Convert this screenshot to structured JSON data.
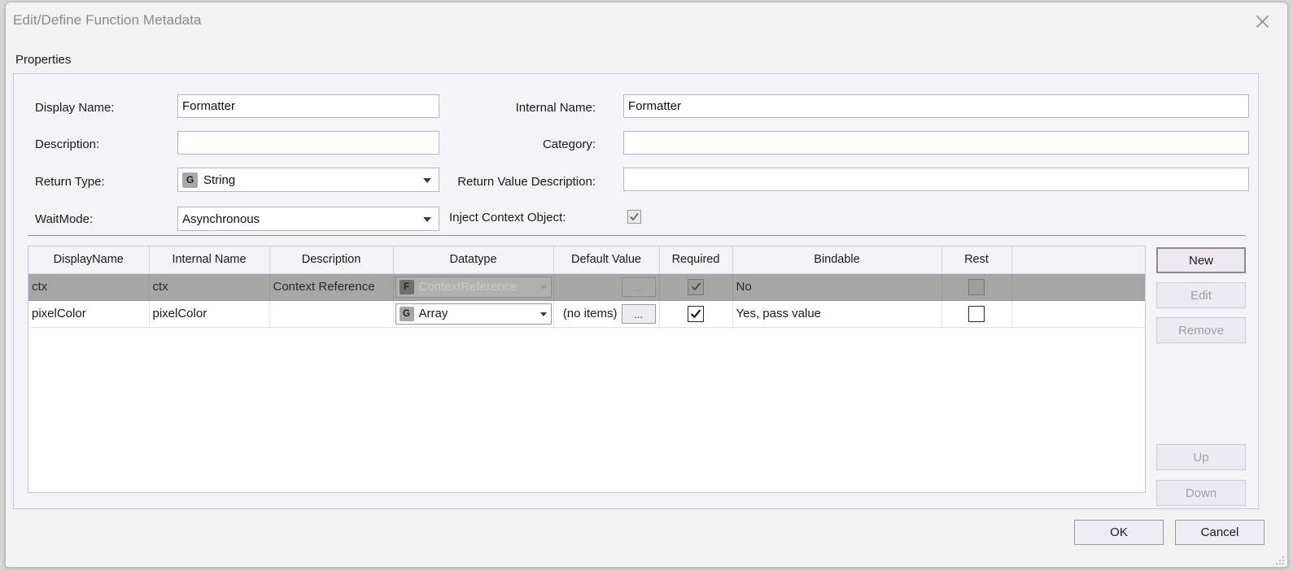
{
  "window": {
    "title": "Edit/Define Function Metadata",
    "close_icon": "close-icon"
  },
  "properties": {
    "section_label": "Properties",
    "fields": {
      "display_name": {
        "label": "Display Name:",
        "value": "Formatter",
        "placeholder": ""
      },
      "description": {
        "label": "Description:",
        "value": "",
        "placeholder": ""
      },
      "return_type": {
        "label": "Return Type:",
        "value": "String",
        "icon": "G"
      },
      "wait_mode": {
        "label": "WaitMode:",
        "value": "Asynchronous"
      },
      "internal_name": {
        "label": "Internal Name:",
        "value": "Formatter",
        "placeholder": ""
      },
      "category": {
        "label": "Category:",
        "value": "",
        "placeholder": ""
      },
      "return_value_description": {
        "label": "Return Value Description:",
        "value": "",
        "placeholder": ""
      },
      "inject_context_object": {
        "label": "Inject Context Object:",
        "checked": true
      }
    }
  },
  "table": {
    "columns": [
      "DisplayName",
      "Internal Name",
      "Description",
      "Datatype",
      "Default Value",
      "Required",
      "Bindable",
      "Rest",
      ""
    ],
    "rows": [
      {
        "selected": true,
        "display_name": "ctx",
        "internal_name": "ctx",
        "description": "Context Reference",
        "datatype": {
          "text": "ContextReference",
          "icon": "F",
          "disabled": true
        },
        "default_value": {
          "text": "",
          "button_label": "...",
          "disabled": true
        },
        "required": {
          "checked": true,
          "disabled": true
        },
        "bindable": "No",
        "rest": {
          "checked": false,
          "disabled": true
        },
        "extra": ""
      },
      {
        "selected": false,
        "display_name": "pixelColor",
        "internal_name": "pixelColor",
        "description": "",
        "datatype": {
          "text": "Array",
          "icon": "G",
          "disabled": false
        },
        "default_value": {
          "text": "(no items)",
          "button_label": "...",
          "disabled": false
        },
        "required": {
          "checked": true,
          "disabled": false
        },
        "bindable": "Yes, pass value",
        "rest": {
          "checked": false,
          "disabled": false
        },
        "extra": ""
      }
    ]
  },
  "side_buttons": {
    "new": {
      "label": "New",
      "enabled": true,
      "default": true
    },
    "edit": {
      "label": "Edit",
      "enabled": false
    },
    "remove": {
      "label": "Remove",
      "enabled": false
    },
    "up": {
      "label": "Up",
      "enabled": false
    },
    "down": {
      "label": "Down",
      "enabled": false
    }
  },
  "footer": {
    "ok": "OK",
    "cancel": "Cancel"
  },
  "colors": {
    "window_background": "#f2f2f2",
    "groupbox_background": "#f4f4f6",
    "field_border": "#b4b6c8",
    "selected_row": "#a6a6a6",
    "title_text": "#8a8a8a",
    "disabled_text": "#a0a0a0"
  }
}
